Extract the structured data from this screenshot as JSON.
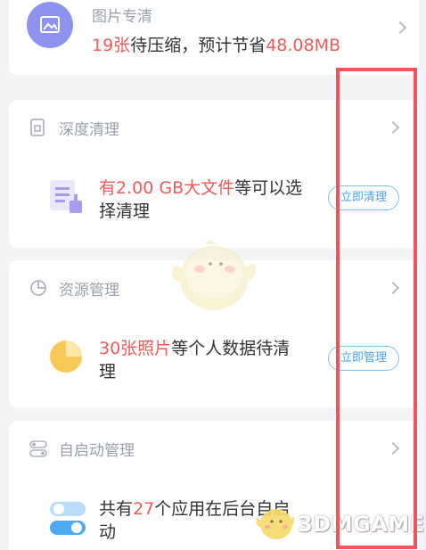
{
  "photo": {
    "title": "图片专清",
    "count": "19张",
    "middle": "待压缩，预计节省",
    "size": "48.08MB"
  },
  "deep_clean": {
    "title": "深度清理",
    "highlight": "有2.00 GB大文件",
    "rest_line1": "等可以选",
    "line2": "择清理",
    "button": "立即清理"
  },
  "resource": {
    "title": "资源管理",
    "highlight": "30张照片",
    "rest_line1": "等个人数据待清",
    "line2": "理",
    "button": "立即管理"
  },
  "autostart": {
    "title": "自启动管理",
    "prefix": "共有",
    "count": "27",
    "rest_line1": "个应用在后台自启",
    "line2": "动"
  },
  "watermark": "3DMGAME",
  "colors": {
    "accent_red": "#f25a5a",
    "button_blue": "#4aa2e6",
    "highlight_box": "#f0535a"
  }
}
